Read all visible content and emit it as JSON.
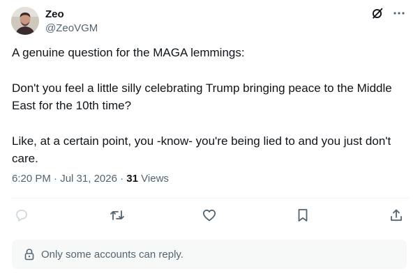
{
  "author": {
    "display_name": "Zeo",
    "handle": "@ZeoVGM"
  },
  "tweet": {
    "paragraphs": [
      "A genuine question for the MAGA lemmings:",
      "Don't you feel a little silly celebrating Trump bringing peace to the Middle East for the 10th time?",
      "Like, at a certain point, you -know- you're being lied to and you just don't care."
    ],
    "time": "6:20 PM",
    "date": "Jul 31, 2026",
    "separator": "·",
    "views_count": "31",
    "views_label": "Views"
  },
  "reply_restriction": {
    "text": "Only some accounts can reply."
  },
  "icons": {
    "header": [
      "grok-icon",
      "more-icon"
    ],
    "actions": [
      "reply-icon",
      "retweet-icon",
      "like-icon",
      "bookmark-icon",
      "share-icon"
    ],
    "restriction": "lock-icon"
  },
  "colors": {
    "text_primary": "#0f1419",
    "text_secondary": "#536471",
    "action_icon": "#536471",
    "reply_icon": "#cfd9de",
    "divider": "#eff3f4",
    "restriction_bg": "#f7f9f9"
  }
}
